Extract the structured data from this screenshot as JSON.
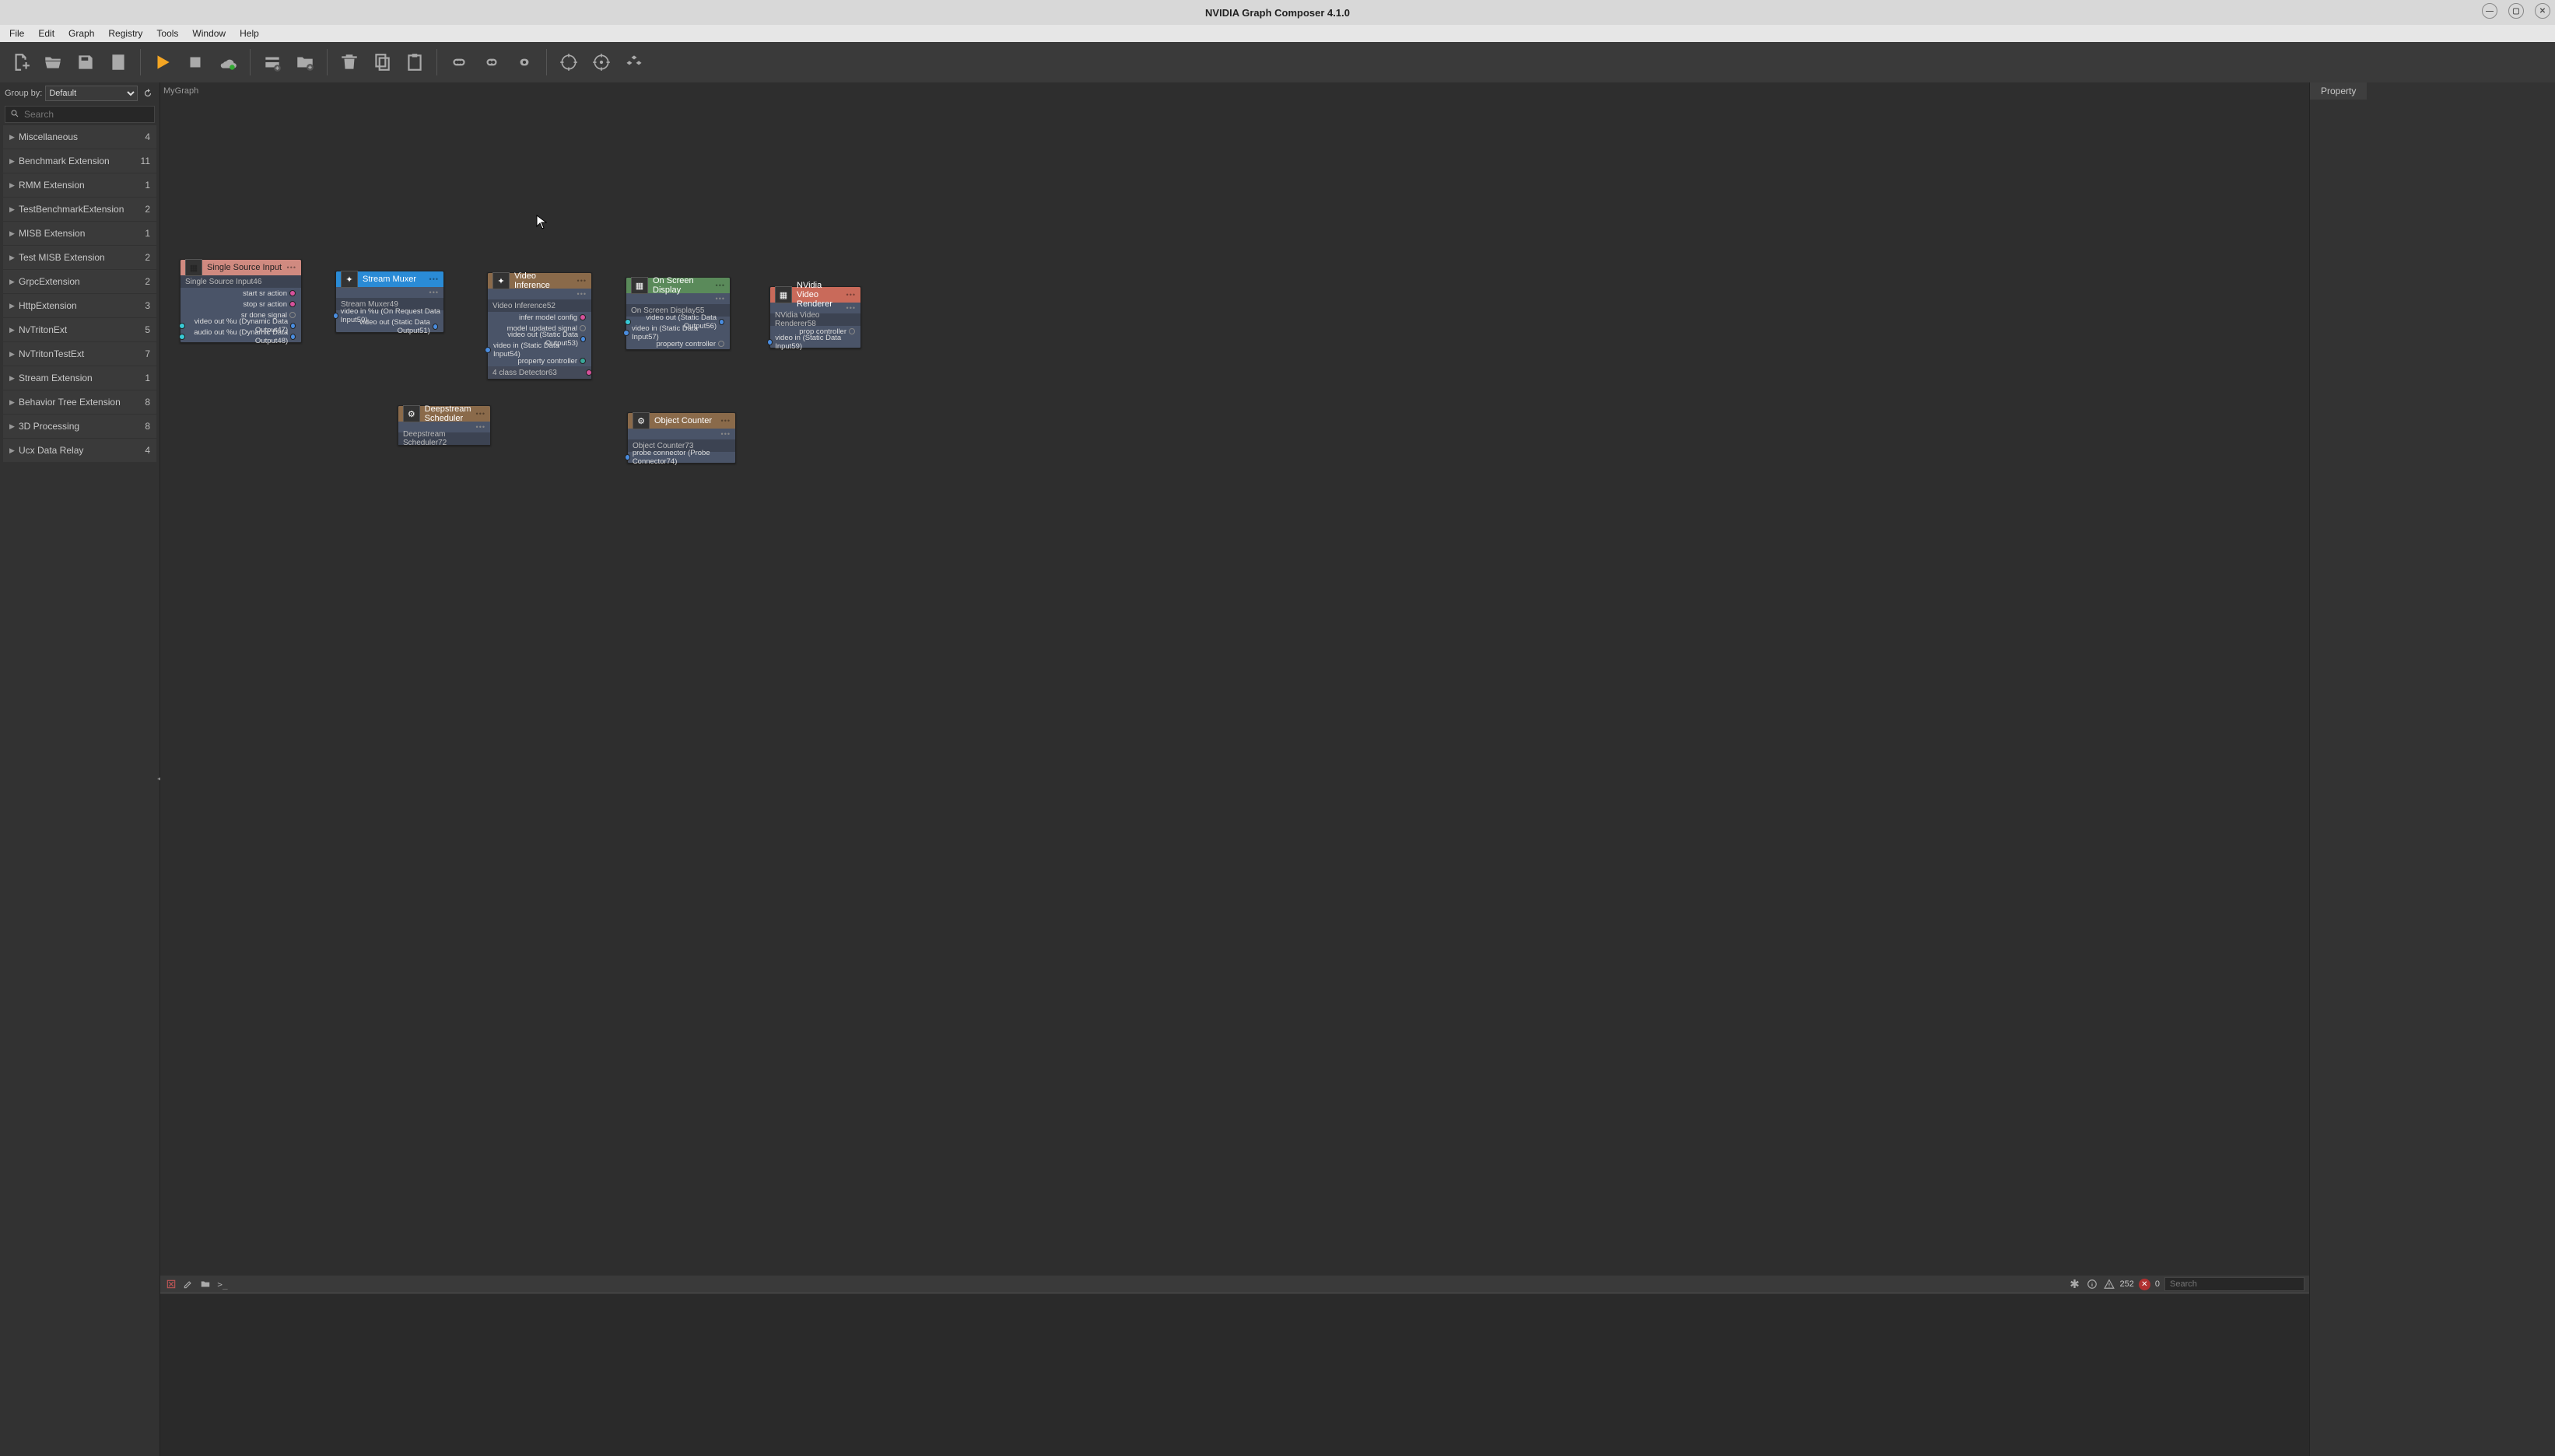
{
  "app": {
    "title": "NVIDIA Graph Composer 4.1.0"
  },
  "menu": {
    "items": [
      "File",
      "Edit",
      "Graph",
      "Registry",
      "Tools",
      "Window",
      "Help"
    ]
  },
  "groupby": {
    "label": "Group by:",
    "value": "Default"
  },
  "search": {
    "placeholder": "Search"
  },
  "categories": [
    {
      "name": "Miscellaneous",
      "count": 4
    },
    {
      "name": "Benchmark Extension",
      "count": 11
    },
    {
      "name": "RMM Extension",
      "count": 1
    },
    {
      "name": "TestBenchmarkExtension",
      "count": 2
    },
    {
      "name": "MISB Extension",
      "count": 1
    },
    {
      "name": "Test MISB Extension",
      "count": 2
    },
    {
      "name": "GrpcExtension",
      "count": 2
    },
    {
      "name": "HttpExtension",
      "count": 3
    },
    {
      "name": "NvTritonExt",
      "count": 5
    },
    {
      "name": "NvTritonTestExt",
      "count": 7
    },
    {
      "name": "Stream Extension",
      "count": 1
    },
    {
      "name": "Behavior Tree Extension",
      "count": 8
    },
    {
      "name": "3D Processing",
      "count": 8
    },
    {
      "name": "Ucx Data Relay",
      "count": 4
    }
  ],
  "tab": {
    "label": "MyGraph"
  },
  "nodes": {
    "ssi": {
      "title": "Single Source Input",
      "sub": "Single Source Input46",
      "rows": [
        {
          "dir": "out",
          "label": "start sr action",
          "color": "c-mag"
        },
        {
          "dir": "out",
          "label": "stop sr action",
          "color": "c-mag"
        },
        {
          "dir": "out",
          "label": "sr done signal",
          "color": "c-empty"
        },
        {
          "dir": "out",
          "label": "video out %u (Dynamic Data Output47)",
          "color": "c-blue",
          "extra": true
        },
        {
          "dir": "out",
          "label": "audio out %u (Dynamic Data Output48)",
          "color": "c-blue",
          "extra": true
        }
      ]
    },
    "mux": {
      "title": "Stream Muxer",
      "sub": "Stream Muxer49",
      "rows": [
        {
          "dir": "in",
          "label": "video in %u (On Request Data Input50)",
          "color": "c-blue"
        },
        {
          "dir": "out",
          "label": "video out (Static Data Output51)",
          "color": "c-blue"
        }
      ]
    },
    "vi": {
      "title": "Video Inference",
      "sub": "Video Inference52",
      "rows": [
        {
          "dir": "out",
          "label": "infer model config",
          "color": "c-mag"
        },
        {
          "dir": "out",
          "label": "model updated signal",
          "color": "c-empty"
        },
        {
          "dir": "out",
          "label": "video out (Static Data Output53)",
          "color": "c-blue"
        },
        {
          "dir": "in",
          "label": "video in (Static Data Input54)",
          "color": "c-blue"
        },
        {
          "dir": "out",
          "label": "property controller",
          "color": "c-teal"
        },
        {
          "dir": "sub",
          "label": "4 class Detector63",
          "color": "c-mag"
        }
      ]
    },
    "osd": {
      "title": "On Screen Display",
      "sub": "On Screen Display55",
      "rows": [
        {
          "dir": "out",
          "label": "video out (Static Data Output56)",
          "color": "c-blue"
        },
        {
          "dir": "in",
          "label": "video in (Static Data Input57)",
          "color": "c-blue"
        },
        {
          "dir": "out",
          "label": "property controller",
          "color": "c-empty"
        }
      ]
    },
    "nvr": {
      "title": "NVidia Video Renderer",
      "sub": "NVidia Video Renderer58",
      "rows": [
        {
          "dir": "out",
          "label": "prop controller",
          "color": "c-empty"
        },
        {
          "dir": "in",
          "label": "video in (Static Data Input59)",
          "color": "c-blue"
        }
      ]
    },
    "ds": {
      "title": "Deepstream Scheduler",
      "sub": "Deepstream Scheduler72"
    },
    "oc": {
      "title": "Object Counter",
      "sub": "Object Counter73",
      "rows": [
        {
          "dir": "in",
          "label": "probe connector (Probe Connector74)",
          "color": "c-blue"
        }
      ]
    }
  },
  "status": {
    "warn_count": "252",
    "err_count": "0",
    "search_placeholder": "Search"
  },
  "property": {
    "tab": "Property"
  },
  "colors": {
    "play": "#f5a623"
  }
}
